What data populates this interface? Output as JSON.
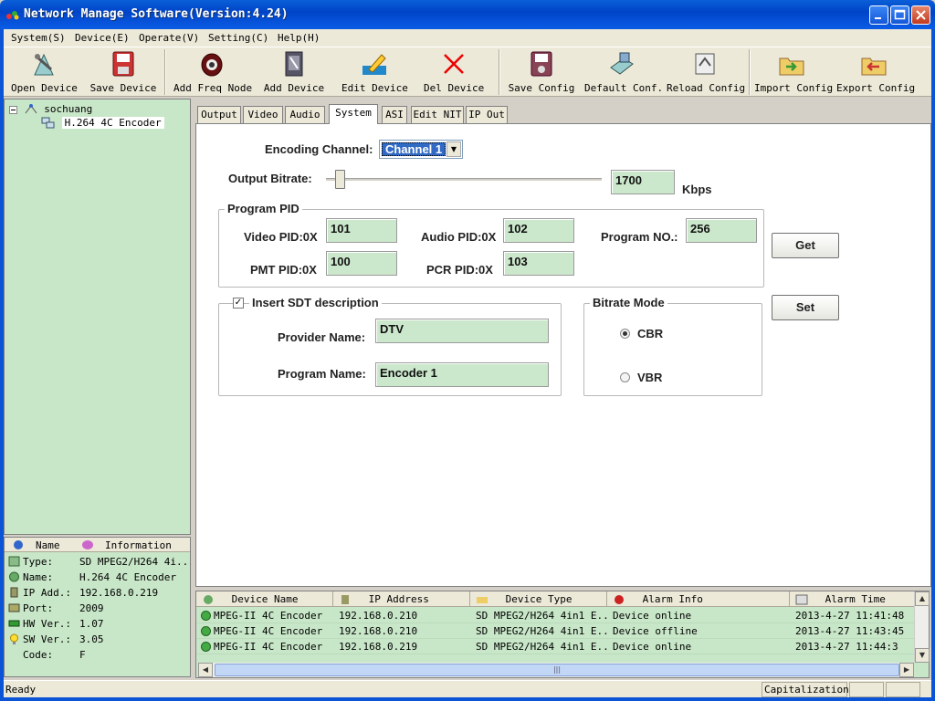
{
  "window": {
    "title": "Network Manage Software(Version:4.24)",
    "accent": "#0a5fd8"
  },
  "menu": [
    {
      "label": "System(S)"
    },
    {
      "label": "Device(E)"
    },
    {
      "label": "Operate(V)"
    },
    {
      "label": "Setting(C)"
    },
    {
      "label": "Help(H)"
    }
  ],
  "toolbar": [
    {
      "label": "Open Device",
      "icon": "open-device-icon"
    },
    {
      "label": "Save Device",
      "icon": "save-device-icon"
    },
    {
      "label": "Add Freq Node",
      "icon": "add-freq-node-icon"
    },
    {
      "label": "Add Device",
      "icon": "add-device-icon"
    },
    {
      "label": "Edit Device",
      "icon": "edit-device-icon"
    },
    {
      "label": "Del Device",
      "icon": "delete-icon"
    },
    {
      "label": "Save Config",
      "icon": "save-config-icon"
    },
    {
      "label": "Default Conf.",
      "icon": "default-config-icon"
    },
    {
      "label": "Reload Config",
      "icon": "reload-config-icon"
    },
    {
      "label": "Import Config",
      "icon": "import-config-icon"
    },
    {
      "label": "Export Config",
      "icon": "export-config-icon"
    }
  ],
  "tree": {
    "root": "sochuang",
    "child": "H.264 4C Encoder"
  },
  "info": {
    "col_name": "Name",
    "col_info": "Information",
    "rows": [
      {
        "key": "Type:",
        "value": "SD MPEG2/H264 4i..."
      },
      {
        "key": "Name:",
        "value": "H.264 4C Encoder"
      },
      {
        "key": "IP Add.:",
        "value": "192.168.0.219"
      },
      {
        "key": "Port:",
        "value": "2009"
      },
      {
        "key": "HW Ver.:",
        "value": "1.07"
      },
      {
        "key": "SW Ver.:",
        "value": "3.05"
      },
      {
        "key": "Code:",
        "value": "F"
      }
    ]
  },
  "tabs": [
    "Output",
    "Video",
    "Audio",
    "System",
    "ASI",
    "Edit NIT",
    "IP Out"
  ],
  "active_tab": "System",
  "form": {
    "encoding_channel_label": "Encoding Channel:",
    "encoding_channel_value": "Channel 1",
    "output_bitrate_label": "Output Bitrate:",
    "output_bitrate_value": "1700",
    "output_bitrate_unit": "Kbps",
    "program_pid_title": "Program PID",
    "video_pid_label": "Video PID:0X",
    "video_pid": "101",
    "audio_pid_label": "Audio PID:0X",
    "audio_pid": "102",
    "program_no_label": "Program NO.:",
    "program_no": "256",
    "pmt_pid_label": "PMT PID:0X",
    "pmt_pid": "100",
    "pcr_pid_label": "PCR PID:0X",
    "pcr_pid": "103",
    "get_label": "Get",
    "set_label": "Set",
    "sdt_title": "Insert SDT description",
    "sdt_checked": true,
    "provider_label": "Provider Name:",
    "provider_value": "DTV",
    "program_name_label": "Program Name:",
    "program_name_value": "Encoder 1",
    "bitrate_mode_title": "Bitrate Mode",
    "cbr_label": "CBR",
    "vbr_label": "VBR",
    "bitrate_mode": "CBR"
  },
  "alarms": {
    "columns": [
      "Device Name",
      "IP Address",
      "Device Type",
      "Alarm Info",
      "Alarm Time"
    ],
    "rows": [
      {
        "name": "MPEG-II 4C Encoder",
        "ip": "192.168.0.210",
        "type": "SD MPEG2/H264 4in1 E...",
        "info": "Device online",
        "time": "2013-4-27 11:41:48"
      },
      {
        "name": "MPEG-II 4C Encoder",
        "ip": "192.168.0.210",
        "type": "SD MPEG2/H264 4in1 E...",
        "info": "Device offline",
        "time": "2013-4-27 11:43:45"
      },
      {
        "name": "MPEG-II 4C Encoder",
        "ip": "192.168.0.219",
        "type": "SD MPEG2/H264 4in1 E...",
        "info": "Device online",
        "time": "2013-4-27 11:44:3"
      }
    ]
  },
  "status": {
    "text": "Ready",
    "caps": "Capitalization"
  }
}
